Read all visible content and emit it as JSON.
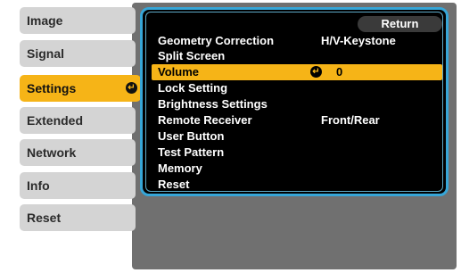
{
  "sidebar": {
    "items": [
      {
        "label": "Image"
      },
      {
        "label": "Signal"
      },
      {
        "label": "Settings"
      },
      {
        "label": "Extended"
      },
      {
        "label": "Network"
      },
      {
        "label": "Info"
      },
      {
        "label": "Reset"
      }
    ],
    "selected_index": 2
  },
  "menu": {
    "return_label": "Return",
    "rows": [
      {
        "label": "Geometry Correction",
        "value": "H/V-Keystone"
      },
      {
        "label": "Split Screen",
        "value": ""
      },
      {
        "label": "Volume",
        "value": "0"
      },
      {
        "label": "Lock Setting",
        "value": ""
      },
      {
        "label": "Brightness Settings",
        "value": ""
      },
      {
        "label": "Remote Receiver",
        "value": "Front/Rear"
      },
      {
        "label": "User Button",
        "value": ""
      },
      {
        "label": "Test Pattern",
        "value": ""
      },
      {
        "label": "Memory",
        "value": ""
      },
      {
        "label": "Reset",
        "value": ""
      }
    ]
  },
  "colors": {
    "accent": "#f6b417",
    "frame": "#36a6d8",
    "sidebar_bg": "#d4d4d4",
    "panel_bg": "#707070"
  }
}
